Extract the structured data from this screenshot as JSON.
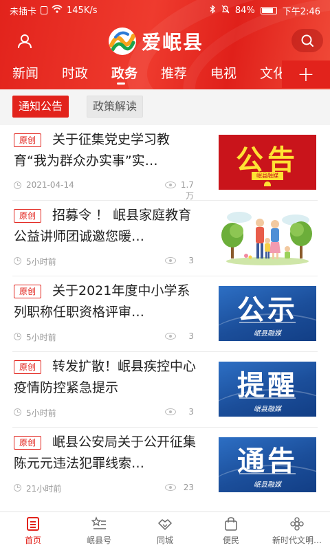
{
  "status_bar": {
    "carrier": "未插卡",
    "speed": "145K/s",
    "battery": "84%",
    "time": "下午2:46"
  },
  "app": {
    "logo_text": "爱岷县",
    "icons": {
      "user": "user-icon",
      "search": "search-icon",
      "plus": "plus-icon"
    }
  },
  "nav": {
    "tabs": [
      {
        "label": "新闻"
      },
      {
        "label": "时政"
      },
      {
        "label": "政务"
      },
      {
        "label": "推荐"
      },
      {
        "label": "电视"
      },
      {
        "label": "文化"
      }
    ],
    "active_index": 2,
    "plus": "+"
  },
  "subtabs": [
    {
      "label": "通知公告",
      "active": true
    },
    {
      "label": "政策解读",
      "active": false
    }
  ],
  "news": [
    {
      "tag": "原创",
      "title": "关于征集党史学习教育“我为群众办实事”实…",
      "time": "2021-04-14",
      "views": "1.7万",
      "thumb": {
        "kind": "red",
        "text": "公告",
        "sub": "岷县融媒"
      }
    },
    {
      "tag": "原创",
      "title": "招募令 ！ 岷县家庭教育公益讲师团诚邀您暖…",
      "time": "5小时前",
      "views": "3",
      "thumb": {
        "kind": "illustration"
      }
    },
    {
      "tag": "原创",
      "title": "关于2021年度中小学系列职称任职资格评审…",
      "time": "5小时前",
      "views": "3",
      "thumb": {
        "kind": "blue",
        "text": "公示",
        "brand": "岷县融媒"
      }
    },
    {
      "tag": "原创",
      "title": "转发扩散！岷县疾控中心疫情防控紧急提示",
      "time": "5小时前",
      "views": "3",
      "thumb": {
        "kind": "blue",
        "text": "提醒",
        "brand": "岷县融媒"
      }
    },
    {
      "tag": "原创",
      "title": "岷县公安局关于公开征集陈元元违法犯罪线索…",
      "time": "21小时前",
      "views": "23",
      "thumb": {
        "kind": "blue",
        "text": "通告",
        "brand": "岷县融媒"
      }
    }
  ],
  "bottom_nav": [
    {
      "label": "首页",
      "icon": "home-icon",
      "active": true
    },
    {
      "label": "岷县号",
      "icon": "star-list-icon",
      "active": false
    },
    {
      "label": "同城",
      "icon": "handshake-icon",
      "active": false
    },
    {
      "label": "便民",
      "icon": "shopping-bag-icon",
      "active": false
    },
    {
      "label": "新时代文明…",
      "icon": "flower-icon",
      "active": false
    }
  ],
  "colors": {
    "brand": "#e2231c",
    "text": "#222222",
    "meta": "#999999"
  }
}
